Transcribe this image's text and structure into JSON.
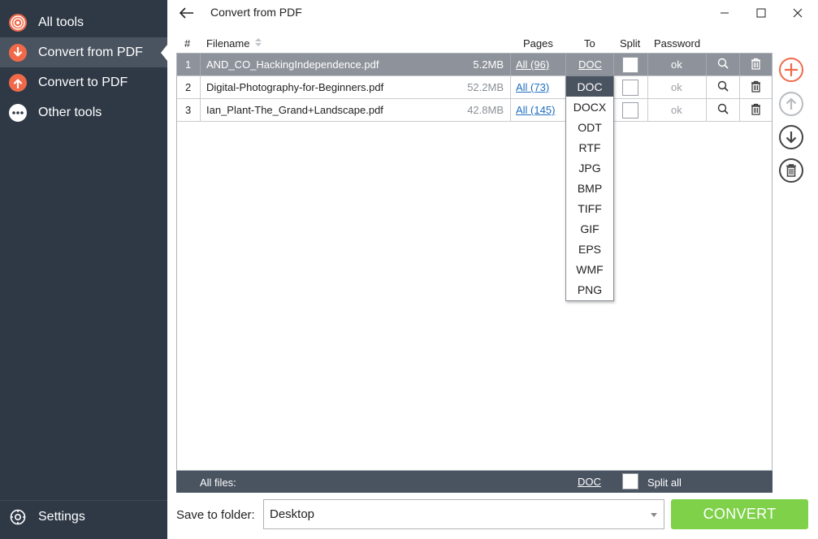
{
  "sidebar": {
    "items": [
      {
        "label": "All tools",
        "icon": "target-icon"
      },
      {
        "label": "Convert from PDF",
        "icon": "arrow-down-circle-icon"
      },
      {
        "label": "Convert to PDF",
        "icon": "arrow-up-circle-icon"
      },
      {
        "label": "Other tools",
        "icon": "more-dots-icon"
      }
    ],
    "settings_label": "Settings",
    "accent": "#f06a4a"
  },
  "window": {
    "title": "Convert from PDF"
  },
  "table": {
    "headers": {
      "num": "#",
      "filename": "Filename",
      "pages": "Pages",
      "to": "To",
      "split": "Split",
      "password": "Password"
    },
    "rows": [
      {
        "num": "1",
        "filename": "AND_CO_HackingIndependence.pdf",
        "size": "5.2MB",
        "pages": "All (96)",
        "to": "DOC",
        "password": "ok"
      },
      {
        "num": "2",
        "filename": "Digital-Photography-for-Beginners.pdf",
        "size": "52.2MB",
        "pages": "All (73)",
        "to": "DOC",
        "password": "ok"
      },
      {
        "num": "3",
        "filename": "Ian_Plant-The_Grand+Landscape.pdf",
        "size": "42.8MB",
        "pages": "All (145)",
        "to": "DOC",
        "password": "ok"
      }
    ],
    "footer": {
      "label": "All files:",
      "format": "DOC",
      "split_all": "Split all"
    }
  },
  "dropdown": {
    "options": [
      "DOC",
      "DOCX",
      "ODT",
      "RTF",
      "JPG",
      "BMP",
      "TIFF",
      "GIF",
      "EPS",
      "WMF",
      "PNG"
    ],
    "selected": "DOC"
  },
  "bottom": {
    "save_label": "Save to folder:",
    "folder": "Desktop",
    "convert": "CONVERT",
    "convert_color": "#7fd14a"
  }
}
